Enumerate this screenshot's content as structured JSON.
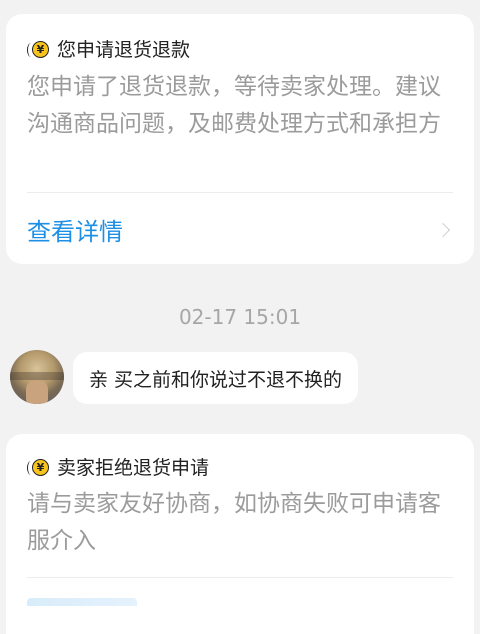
{
  "cards": [
    {
      "icon": "yen-refund-icon",
      "title": "您申请退货退款",
      "body": "您申请了退货退款，等待卖家处理。建议沟通商品问题，及邮费处理方式和承担方",
      "link": "查看详情"
    },
    {
      "icon": "yen-refund-icon",
      "title": "卖家拒绝退货申请",
      "body": "请与卖家友好协商，如协商失败可申请客服介入"
    }
  ],
  "timestamp": "02-17 15:01",
  "message": {
    "text": "亲 买之前和你说过不退不换的"
  },
  "colors": {
    "background": "#f2f2f2",
    "card": "#ffffff",
    "link": "#1e8fe6",
    "muted_text": "#9b9b9b",
    "title_text": "#222222",
    "coin": "#f7c31d"
  }
}
